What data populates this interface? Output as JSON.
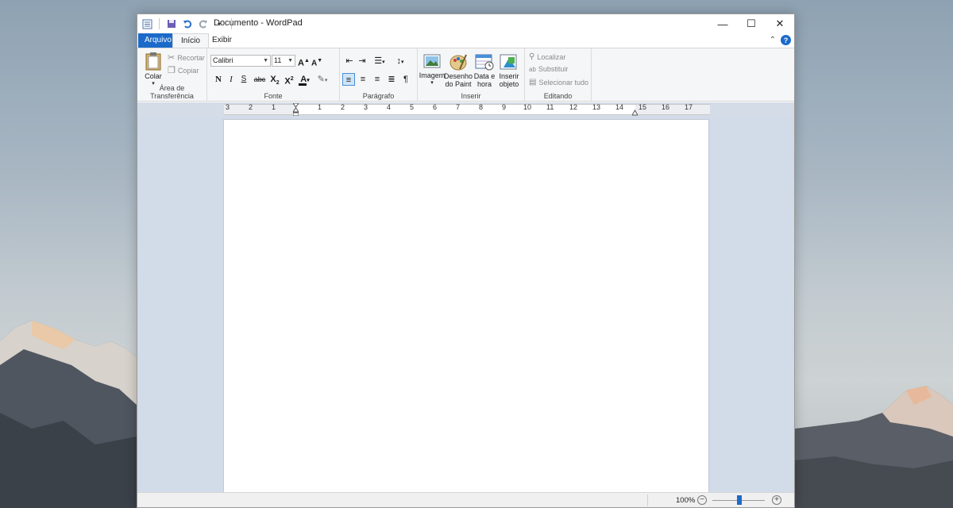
{
  "window": {
    "title": "Documento - WordPad",
    "controls": {
      "minimize": "—",
      "maximize": "☐",
      "close": "✕"
    }
  },
  "tabs": [
    {
      "label": "Arquivo",
      "active": false
    },
    {
      "label": "Início",
      "active": true
    },
    {
      "label": "Exibir",
      "active": false
    }
  ],
  "ribbon": {
    "clipboard": {
      "label": "Área de Transferência",
      "paste": "Colar",
      "cut": "Recortar",
      "copy": "Copiar"
    },
    "font": {
      "label": "Fonte",
      "family": "Calibri",
      "size": "11"
    },
    "paragraph": {
      "label": "Parágrafo"
    },
    "insert": {
      "label": "Inserir",
      "image": "Imagem",
      "paint_line1": "Desenho",
      "paint_line2": "do Paint",
      "datetime_line1": "Data e",
      "datetime_line2": "hora",
      "object_line1": "Inserir",
      "object_line2": "objeto"
    },
    "editing": {
      "label": "Editando",
      "find": "Localizar",
      "replace": "Substituir",
      "select_all": "Selecionar tudo"
    }
  },
  "ruler": {
    "numbers": [
      "3",
      "2",
      "1",
      "1",
      "2",
      "3",
      "4",
      "5",
      "6",
      "7",
      "8",
      "9",
      "10",
      "11",
      "12",
      "13",
      "14",
      "15",
      "16",
      "17"
    ]
  },
  "status": {
    "zoom": "100%"
  },
  "colors": {
    "accent": "#1b6ac9",
    "ribbon_bg": "#f5f6f7",
    "workspace_bg": "#d2dbe8"
  }
}
